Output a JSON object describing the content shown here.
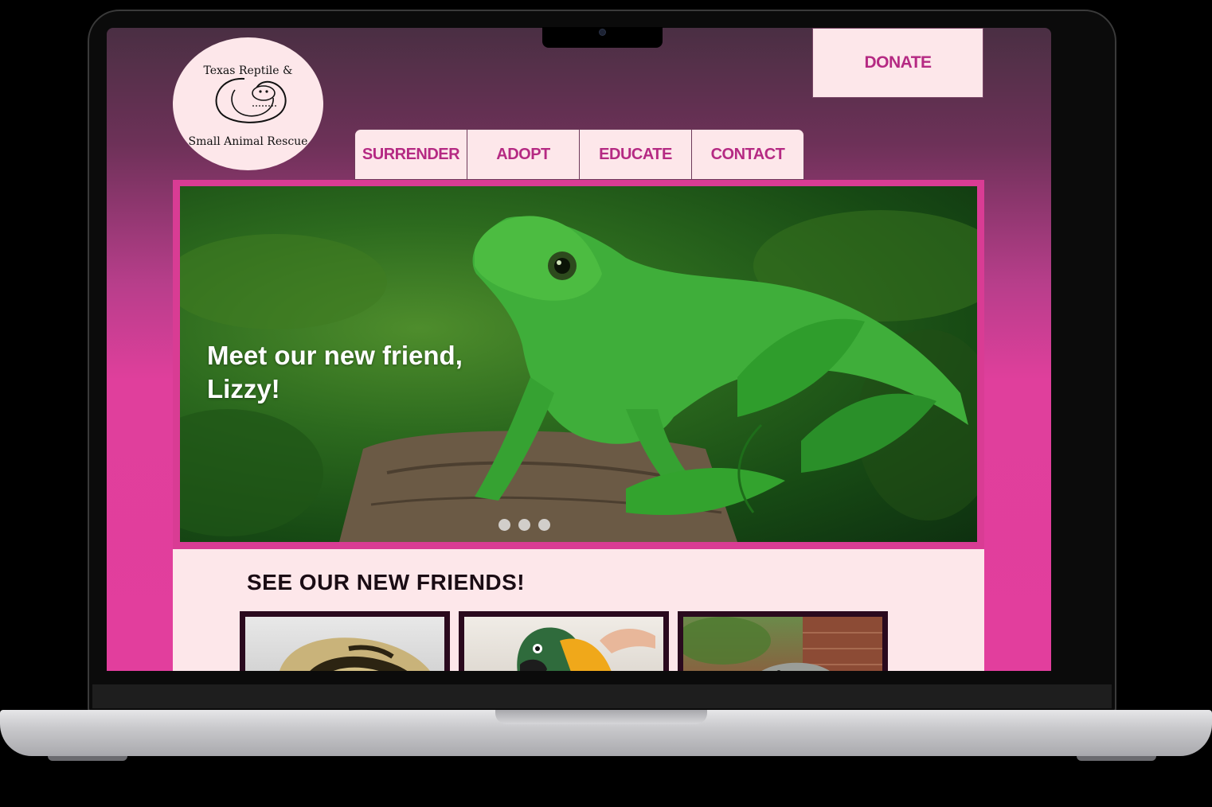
{
  "site": {
    "logo_line1": "Texas Reptile &",
    "logo_line2": "Small Animal Rescue"
  },
  "header": {
    "donate_label": "DONATE"
  },
  "nav": {
    "items": [
      {
        "label": "SURRENDER"
      },
      {
        "label": "ADOPT"
      },
      {
        "label": "EDUCATE"
      },
      {
        "label": "CONTACT"
      }
    ]
  },
  "hero": {
    "caption": "Meet our new friend, Lizzy!",
    "slide_count": 3,
    "active_slide": 1
  },
  "friends": {
    "title": "SEE OUR NEW FRIENDS!",
    "cards": [
      {
        "icon": "ball-python-photo"
      },
      {
        "icon": "macaw-photo"
      },
      {
        "icon": "iguana-photo"
      }
    ]
  },
  "colors": {
    "accent": "#b52a83",
    "panel": "#fde7ea",
    "gradient_top": "#4a2f43",
    "gradient_bottom": "#e23e9d"
  }
}
